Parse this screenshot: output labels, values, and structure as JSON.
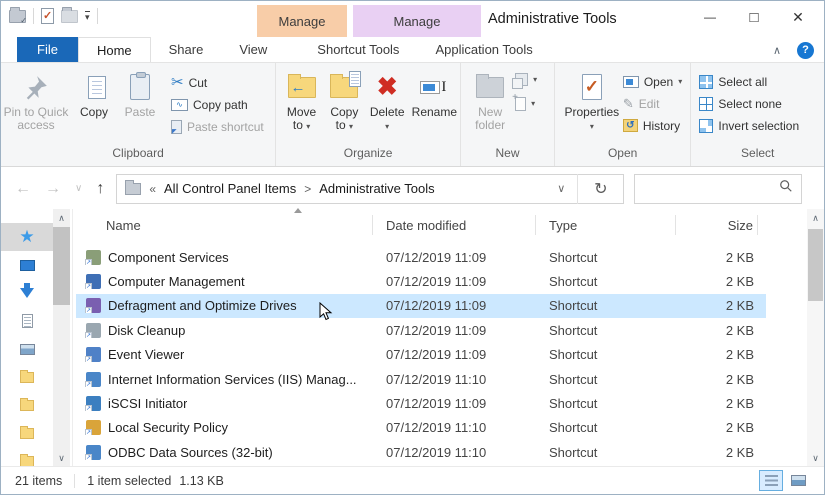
{
  "window": {
    "title": "Administrative Tools"
  },
  "titlebar": {
    "manage_shortcut": "Manage",
    "manage_application": "Manage"
  },
  "tabs": {
    "file": "File",
    "home": "Home",
    "share": "Share",
    "view": "View",
    "shortcut_tools": "Shortcut Tools",
    "application_tools": "Application Tools"
  },
  "ribbon": {
    "clipboard": {
      "label": "Clipboard",
      "pin_line1": "Pin to Quick",
      "pin_line2": "access",
      "copy": "Copy",
      "paste": "Paste",
      "cut": "Cut",
      "copy_path": "Copy path",
      "paste_shortcut": "Paste shortcut"
    },
    "organize": {
      "label": "Organize",
      "move_line1": "Move",
      "move_line2": "to",
      "copy_line1": "Copy",
      "copy_line2": "to",
      "delete": "Delete",
      "rename": "Rename"
    },
    "new_group": {
      "label": "New",
      "new_folder_line1": "New",
      "new_folder_line2": "folder"
    },
    "open_group": {
      "label": "Open",
      "properties": "Properties",
      "open": "Open",
      "edit": "Edit",
      "history": "History"
    },
    "select_group": {
      "label": "Select",
      "select_all": "Select all",
      "select_none": "Select none",
      "invert": "Invert selection"
    }
  },
  "address_bar": {
    "root_chevrons": "«",
    "crumb_1": "All Control Panel Items",
    "separator": ">",
    "crumb_2": "Administrative Tools"
  },
  "search": {
    "value": "",
    "placeholder": ""
  },
  "sidebar": {
    "items": [
      {
        "name": "quick-access",
        "icon": "star",
        "highlight": true
      },
      {
        "name": "this-pc",
        "icon": "monitor",
        "highlight": false
      },
      {
        "name": "downloads",
        "icon": "arrow-down",
        "highlight": false
      },
      {
        "name": "documents",
        "icon": "document",
        "highlight": false
      },
      {
        "name": "pictures",
        "icon": "picture",
        "highlight": false
      },
      {
        "name": "folder-1",
        "icon": "folder",
        "highlight": false
      },
      {
        "name": "folder-2",
        "icon": "folder",
        "highlight": false
      },
      {
        "name": "folder-3",
        "icon": "folder",
        "highlight": false
      },
      {
        "name": "folder-4",
        "icon": "folder",
        "highlight": false
      }
    ]
  },
  "list": {
    "columns": {
      "name": "Name",
      "date": "Date modified",
      "type": "Type",
      "size": "Size"
    },
    "files": [
      {
        "name": "Component Services",
        "date": "07/12/2019 11:09",
        "type": "Shortcut",
        "size": "2 KB",
        "icon_color": "#8a9e78",
        "selected": false
      },
      {
        "name": "Computer Management",
        "date": "07/12/2019 11:09",
        "type": "Shortcut",
        "size": "2 KB",
        "icon_color": "#3f6fb5",
        "selected": false
      },
      {
        "name": "Defragment and Optimize Drives",
        "date": "07/12/2019 11:09",
        "type": "Shortcut",
        "size": "2 KB",
        "icon_color": "#7a5fb0",
        "selected": true
      },
      {
        "name": "Disk Cleanup",
        "date": "07/12/2019 11:09",
        "type": "Shortcut",
        "size": "2 KB",
        "icon_color": "#9aa7b0",
        "selected": false
      },
      {
        "name": "Event Viewer",
        "date": "07/12/2019 11:09",
        "type": "Shortcut",
        "size": "2 KB",
        "icon_color": "#4f81c7",
        "selected": false
      },
      {
        "name": "Internet Information Services (IIS) Manag...",
        "date": "07/12/2019 11:10",
        "type": "Shortcut",
        "size": "2 KB",
        "icon_color": "#4a86c8",
        "selected": false
      },
      {
        "name": "iSCSI Initiator",
        "date": "07/12/2019 11:09",
        "type": "Shortcut",
        "size": "2 KB",
        "icon_color": "#3c7fc0",
        "selected": false
      },
      {
        "name": "Local Security Policy",
        "date": "07/12/2019 11:10",
        "type": "Shortcut",
        "size": "2 KB",
        "icon_color": "#d9a43a",
        "selected": false
      },
      {
        "name": "ODBC Data Sources (32-bit)",
        "date": "07/12/2019 11:10",
        "type": "Shortcut",
        "size": "2 KB",
        "icon_color": "#4a86c8",
        "selected": false
      }
    ]
  },
  "statusbar": {
    "items_count": "21 items",
    "selection": "1 item selected",
    "selection_size": "1.13 KB"
  },
  "colors": {
    "accent_blue": "#1a68b8",
    "selection_blue": "#cce8ff",
    "manage_orange": "#f8cda8",
    "manage_purple": "#e9d0f3",
    "delete_red": "#cf2d23",
    "help_blue": "#1777d2",
    "quick_access_star": "#3c9be8"
  }
}
